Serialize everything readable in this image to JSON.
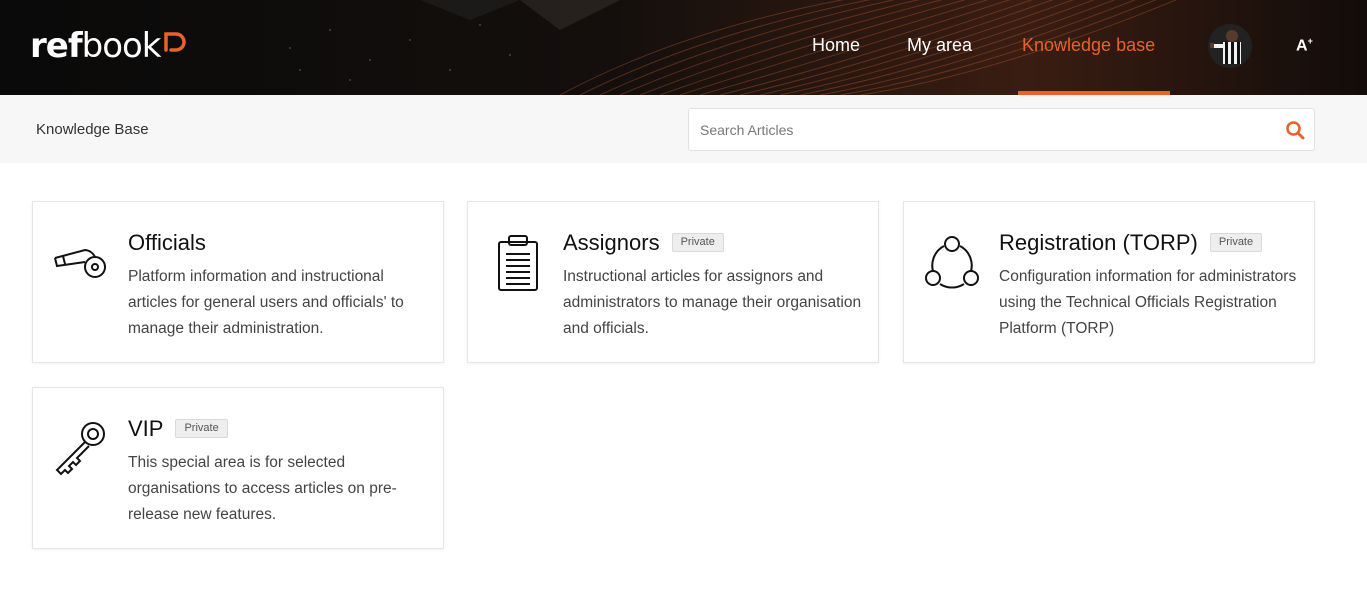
{
  "header": {
    "logo_ref": "ref",
    "logo_book": "book",
    "nav": [
      {
        "label": "Home"
      },
      {
        "label": "My area"
      },
      {
        "label": "Knowledge base"
      }
    ],
    "font_toggle": "A",
    "font_toggle_sup": "+",
    "accent_color": "#e8622a"
  },
  "subbar": {
    "title": "Knowledge Base",
    "search_placeholder": "Search Articles",
    "search_value": ""
  },
  "cards": [
    {
      "title": "Officials",
      "badge": "",
      "icon": "whistle-icon",
      "description": "Platform information and instructional articles for general users and officials' to manage their administration."
    },
    {
      "title": "Assignors",
      "badge": "Private",
      "icon": "clipboard-icon",
      "description": "Instructional articles for assignors and administrators to manage their organisation and officials."
    },
    {
      "title": "Registration (TORP)",
      "badge": "Private",
      "icon": "network-icon",
      "description": "Configuration information for administrators using the Technical Officials Registration Platform (TORP)"
    },
    {
      "title": "VIP",
      "badge": "Private",
      "icon": "key-icon",
      "description": "This special area is for selected organisations to access articles on pre-release new features."
    }
  ]
}
